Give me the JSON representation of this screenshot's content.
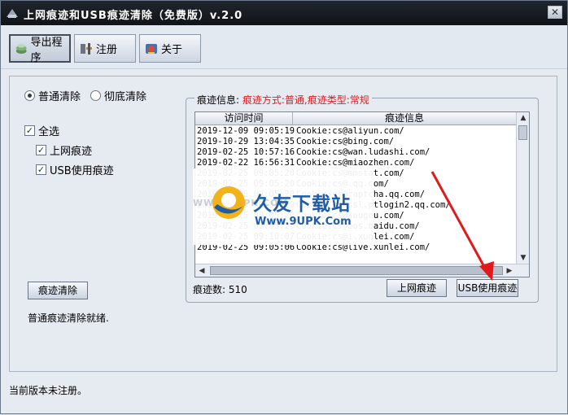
{
  "window": {
    "title": "上网痕迹和USB痕迹清除（免费版）v.2.0",
    "close_label": "✕"
  },
  "toolbar": {
    "export_label": "导出程序",
    "register_label": "注册",
    "about_label": "关于"
  },
  "options": {
    "mode_normal_label": "普通清除",
    "mode_thorough_label": "彻底清除",
    "select_all_label": "全选",
    "internet_traces_label": "上网痕迹",
    "usb_traces_label": "USB使用痕迹"
  },
  "left": {
    "clear_button_label": "痕迹清除",
    "status_message": "普通痕迹清除就绪."
  },
  "trace_panel": {
    "legend_prefix": "痕迹信息: ",
    "legend_detail": "痕迹方式:普通,痕迹类型:常规",
    "columns": [
      "访问时间",
      "痕迹信息"
    ],
    "rows": [
      {
        "time": "2019-12-09 09:05:19",
        "info": "Cookie:cs@aliyun.com/"
      },
      {
        "time": "2019-10-29 13:04:35",
        "info": "Cookie:cs@bing.com/"
      },
      {
        "time": "2019-02-25 10:57:16",
        "info": "Cookie:cs@wan.ludashi.com/"
      },
      {
        "time": "2019-02-22 16:56:31",
        "info": "Cookie:cs@miaozhen.com/"
      },
      {
        "time": "2019-02-25 09:05:20",
        "info": "Cookie:cs@mmstat.com/"
      },
      {
        "time": "2019-02-25 09:05:20",
        "info": "Cookie:cs@.qq.com/"
      },
      {
        "time": "2019-02-25 09:05:20",
        "info": "Cookie:cs@captcha.qq.com/"
      },
      {
        "time": "2019-02-25 09:05:20",
        "info": "Cookie:cs@ssl.ptlogin2.qq.com/"
      },
      {
        "time": "2019-02-25 09:05:20",
        "info": "Cookie:cs@sougou.com/"
      },
      {
        "time": "2019-02-25 09:05:20",
        "info": "Cookie:cs@pos.baidu.com/"
      },
      {
        "time": "2019-02-25 09:10:07",
        "info": "Cookie:cs@i.xunlei.com/"
      },
      {
        "time": "2019-02-25 09:05:06",
        "info": "Cookie:cs@live.xunlei.com/"
      }
    ],
    "count_text": "痕迹数: 510",
    "internet_button_label": "上网痕迹",
    "usb_button_label": "USB使用痕迹"
  },
  "watermark": {
    "side_text": "WWW.9UPK.COM",
    "logo_text": "9UPK",
    "title": "久友下载站",
    "url": "Www.9UPK.Com"
  },
  "statusbar": {
    "text": "当前版本未注册。"
  },
  "colors": {
    "accent_red": "#d81e1e",
    "arrow_red": "#e01a1a",
    "brand_blue": "#1f5ca6"
  }
}
